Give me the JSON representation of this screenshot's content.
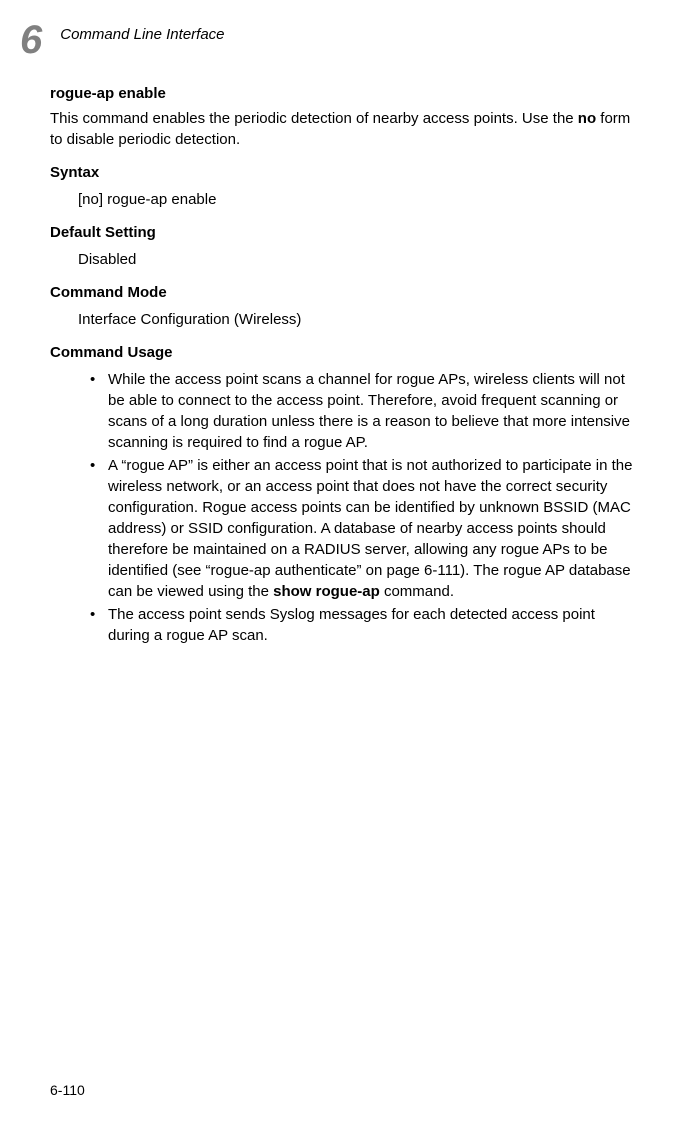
{
  "header": {
    "chapter_num": "6",
    "chapter_title": "Command Line Interface"
  },
  "command": {
    "title": "rogue-ap enable",
    "description_pre": "This command enables the periodic detection of nearby access points. Use the ",
    "description_bold": "no",
    "description_post": " form to disable periodic detection."
  },
  "syntax": {
    "heading": "Syntax",
    "value": "[no] rogue-ap enable"
  },
  "default_setting": {
    "heading": "Default Setting",
    "value": "Disabled"
  },
  "command_mode": {
    "heading": "Command Mode",
    "value": "Interface Configuration (Wireless)"
  },
  "command_usage": {
    "heading": "Command Usage",
    "items": [
      {
        "pre": "While the access point scans a channel for rogue APs, wireless clients will not be able to connect to the access point. Therefore, avoid frequent scanning or scans of a long duration unless there is a reason to believe that more intensive scanning is required to find a rogue AP.",
        "bold": "",
        "post": ""
      },
      {
        "pre": "A “rogue AP” is either an access point that is not authorized to participate in the wireless network, or an access point that does not have the correct security configuration. Rogue access points can be identified by unknown BSSID (MAC address) or SSID configuration. A database of nearby access points should therefore be maintained on a RADIUS server, allowing any rogue APs to be identified (see “rogue-ap authenticate” on page 6-111). The rogue AP database can be viewed using the ",
        "bold": "show rogue-ap",
        "post": " command."
      },
      {
        "pre": "The access point sends Syslog messages for each detected access point during a rogue AP scan.",
        "bold": "",
        "post": ""
      }
    ]
  },
  "page_num": "6-110"
}
